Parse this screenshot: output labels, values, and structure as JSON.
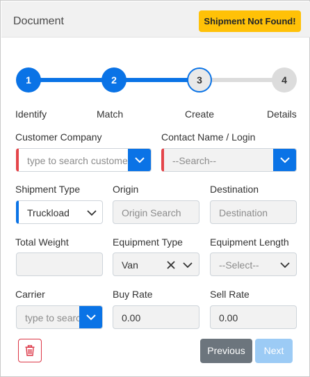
{
  "header": {
    "title": "Document",
    "badge": "Shipment Not Found!"
  },
  "stepper": {
    "steps": [
      {
        "number": "1",
        "label": "Identify",
        "state": "done"
      },
      {
        "number": "2",
        "label": "Match",
        "state": "done"
      },
      {
        "number": "3",
        "label": "Create",
        "state": "current"
      },
      {
        "number": "4",
        "label": "Details",
        "state": "todo"
      }
    ]
  },
  "form": {
    "customer_company": {
      "label": "Customer Company",
      "placeholder": "type to search customer"
    },
    "contact_name": {
      "label": "Contact Name / Login",
      "placeholder": "--Search--"
    },
    "shipment_type": {
      "label": "Shipment Type",
      "value": "Truckload"
    },
    "origin": {
      "label": "Origin",
      "placeholder": "Origin Search"
    },
    "destination": {
      "label": "Destination",
      "placeholder": "Destination"
    },
    "total_weight": {
      "label": "Total Weight",
      "value": ""
    },
    "equipment_type": {
      "label": "Equipment Type",
      "value": "Van"
    },
    "equipment_length": {
      "label": "Equipment Length",
      "placeholder": "--Select--"
    },
    "carrier": {
      "label": "Carrier",
      "placeholder": "type to search"
    },
    "buy_rate": {
      "label": "Buy Rate",
      "value": "0.00"
    },
    "sell_rate": {
      "label": "Sell Rate",
      "value": "0.00"
    }
  },
  "actions": {
    "previous_label": "Previous",
    "next_label": "Next"
  },
  "colors": {
    "primary": "#0a73e6",
    "warning": "#ffc107",
    "danger": "#dc3545",
    "secondary": "#6c757d",
    "disabled_primary": "#9ccbf5",
    "required_marker": "#e4454a"
  }
}
